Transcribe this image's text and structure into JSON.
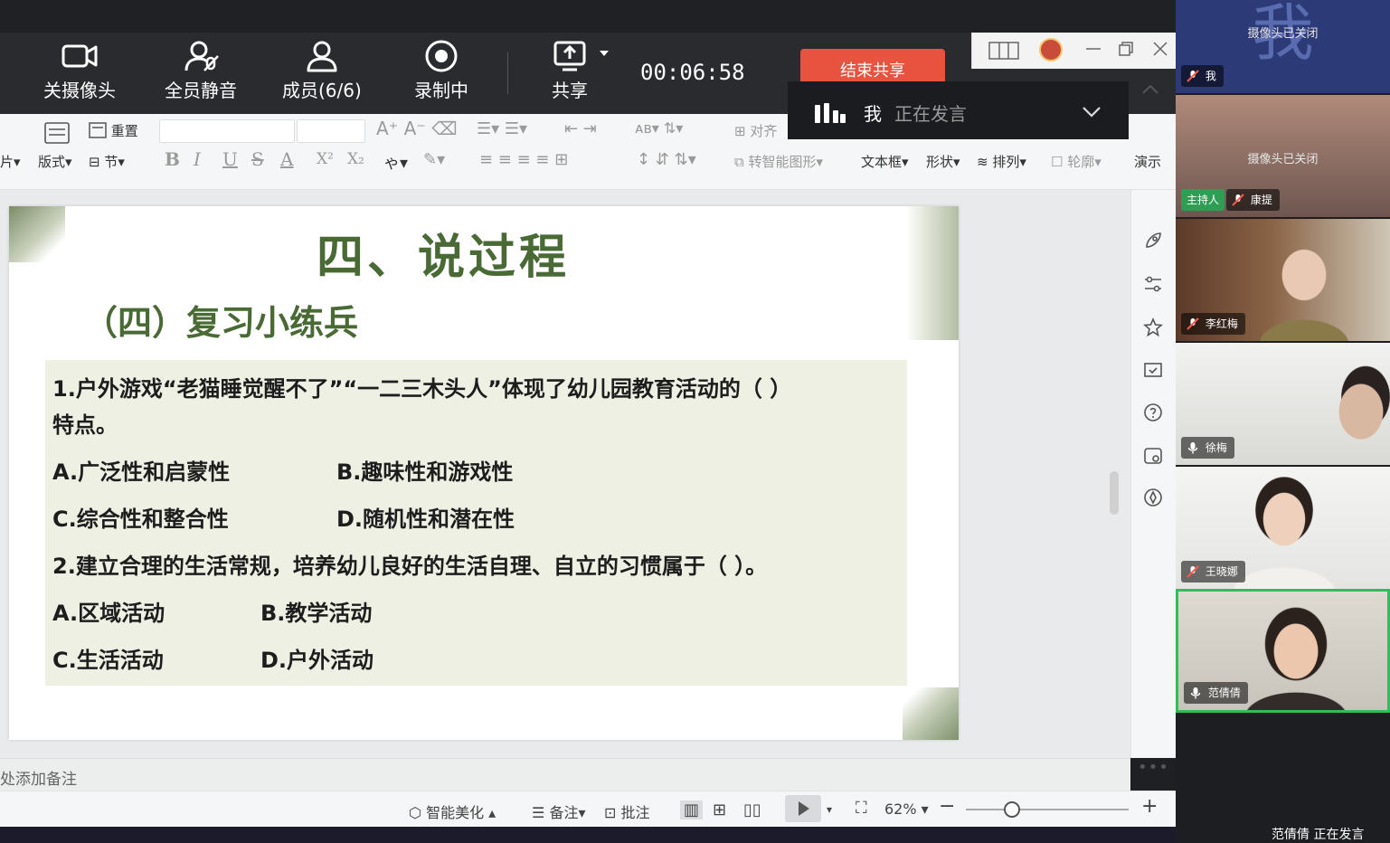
{
  "meeting": {
    "buttons": {
      "camera_off": "关摄像头",
      "mute_all": "全员静音",
      "members": "成员(6/6)",
      "recording": "录制中",
      "share": "共享"
    },
    "timer": "00:06:58",
    "end_share": "结束共享"
  },
  "speaking_banner": {
    "me": "我",
    "status": "正在发言"
  },
  "ribbon": {
    "row1": {
      "reset": "重置",
      "align": "对齐"
    },
    "row2": {
      "picture": "片",
      "layout": "版式",
      "section": "节",
      "convert_smartart": "转智能图形",
      "textbox": "文本框",
      "shape": "形状",
      "arrange": "排列",
      "outline": "轮廓",
      "present": "演示"
    },
    "format_glyphs": [
      "B",
      "I",
      "U",
      "S",
      "A",
      "X²",
      "X₂"
    ]
  },
  "slide": {
    "title": "四、说过程",
    "subtitle": "（四）复习小练兵",
    "questions": [
      {
        "stem_line1": "1.户外游戏“老猫睡觉醒不了”“一二三木头人”体现了幼儿园教育活动的（   ）",
        "stem_line2": "特点。",
        "options": [
          "A.广泛性和启蒙性",
          "B.趣味性和游戏性",
          "C.综合性和整合性",
          "D.随机性和潜在性"
        ]
      },
      {
        "stem_line1": "2.建立合理的生活常规，培养幼儿良好的生活自理、自立的习惯属于（   ）。",
        "options": [
          "A.区域活动",
          "B.教学活动",
          "C.生活活动",
          "D.户外活动"
        ]
      }
    ]
  },
  "notes": {
    "placeholder": "处添加备注"
  },
  "status_bar": {
    "smart_beautify": "智能美化",
    "notes": "备注",
    "comment": "批注",
    "zoom": "62%"
  },
  "participants": [
    {
      "name": "我",
      "bg_char": "我",
      "camera_text": "摄像头已关闭"
    },
    {
      "name": "康提",
      "host_label": "主持人",
      "camera_text": "摄像头已关闭"
    },
    {
      "name": "李红梅"
    },
    {
      "name": "徐梅"
    },
    {
      "name": "王晓娜"
    },
    {
      "name": "范倩倩"
    }
  ],
  "footer": {
    "speaker": "范倩倩  正在发言"
  },
  "colors": {
    "title_green": "#4a6a35",
    "end_share_red": "#e8533f",
    "active_border": "#2fbf5a",
    "host_tag": "#2f9e55"
  }
}
